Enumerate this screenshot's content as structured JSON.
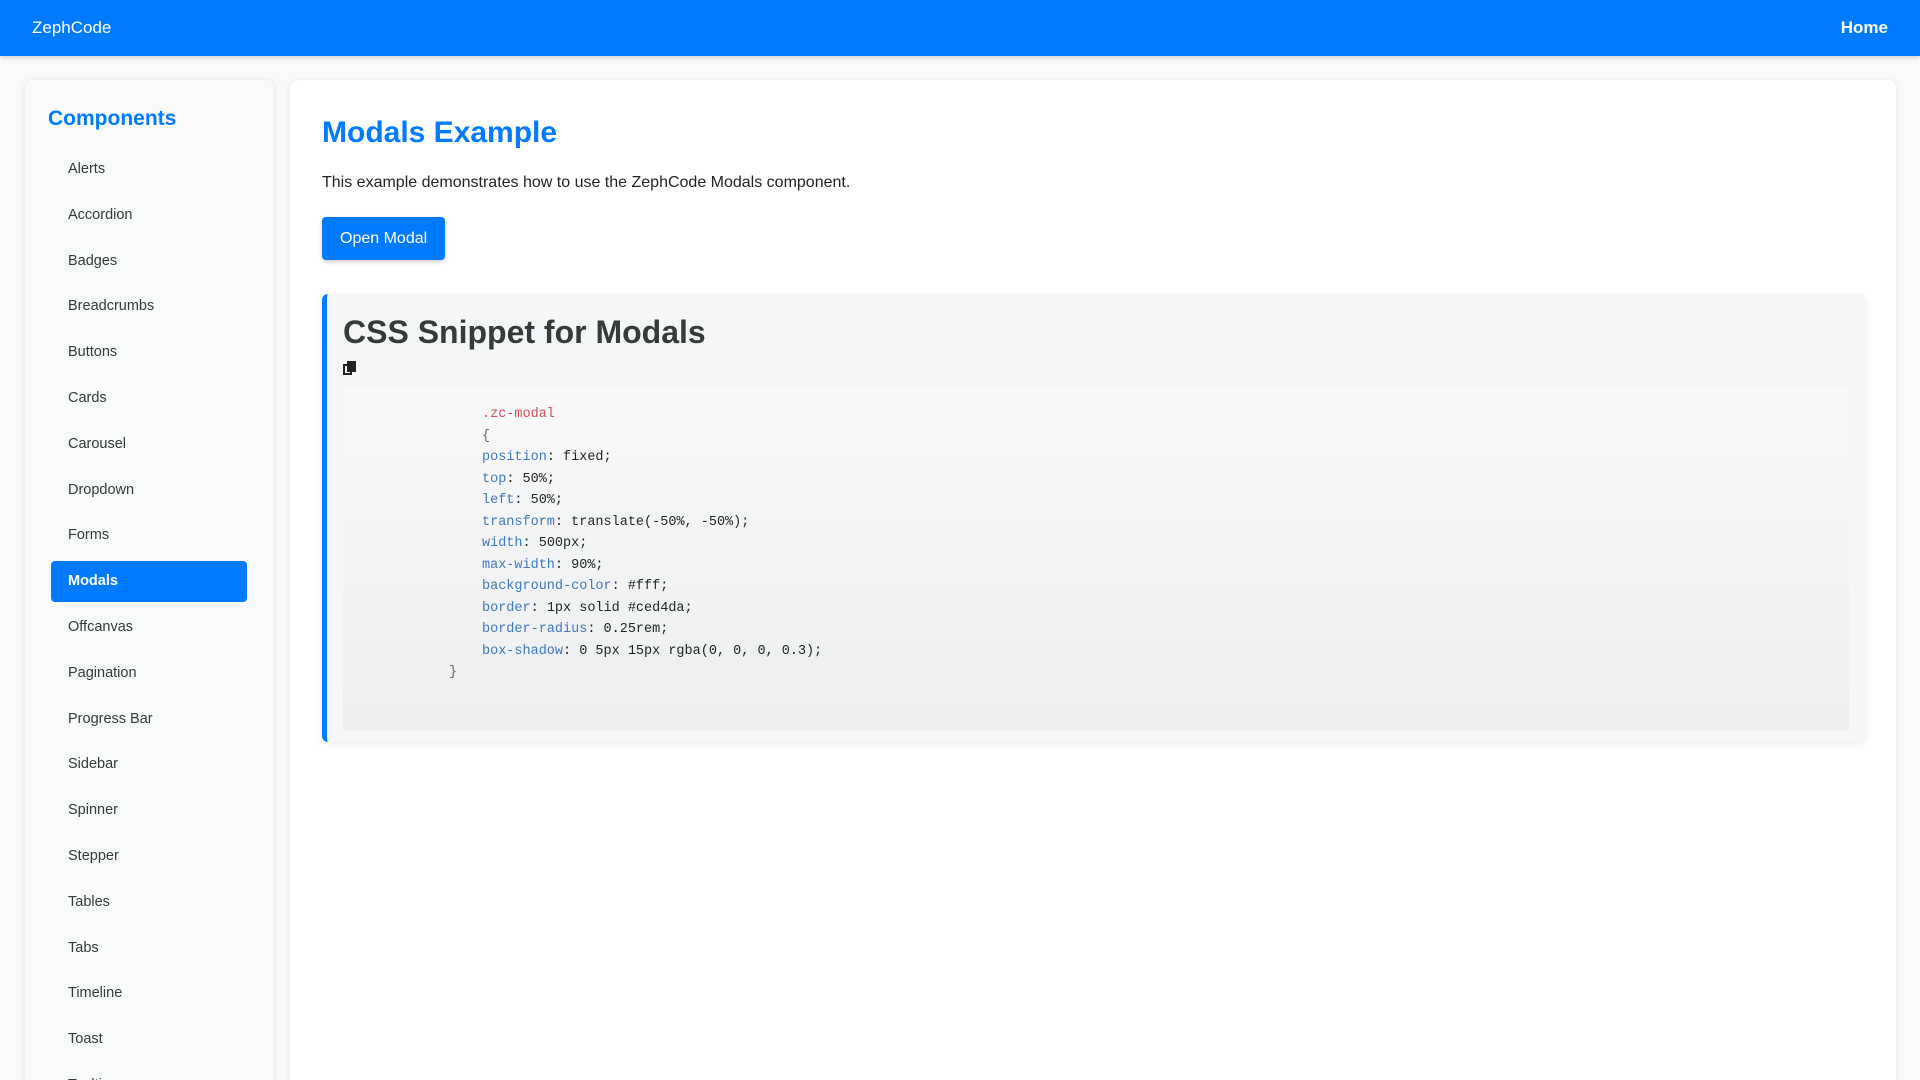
{
  "navbar": {
    "brand": "ZephCode",
    "home": "Home",
    "color": "#007bff"
  },
  "sidebar": {
    "title": "Components",
    "items": [
      {
        "label": "Alerts",
        "active": false
      },
      {
        "label": "Accordion",
        "active": false
      },
      {
        "label": "Badges",
        "active": false
      },
      {
        "label": "Breadcrumbs",
        "active": false
      },
      {
        "label": "Buttons",
        "active": false
      },
      {
        "label": "Cards",
        "active": false
      },
      {
        "label": "Carousel",
        "active": false
      },
      {
        "label": "Dropdown",
        "active": false
      },
      {
        "label": "Forms",
        "active": false
      },
      {
        "label": "Modals",
        "active": true
      },
      {
        "label": "Offcanvas",
        "active": false
      },
      {
        "label": "Pagination",
        "active": false
      },
      {
        "label": "Progress Bar",
        "active": false
      },
      {
        "label": "Sidebar",
        "active": false
      },
      {
        "label": "Spinner",
        "active": false
      },
      {
        "label": "Stepper",
        "active": false
      },
      {
        "label": "Tables",
        "active": false
      },
      {
        "label": "Tabs",
        "active": false
      },
      {
        "label": "Timeline",
        "active": false
      },
      {
        "label": "Toast",
        "active": false
      },
      {
        "label": "Tooltips",
        "active": false
      }
    ]
  },
  "main": {
    "title": "Modals Example",
    "description": "This example demonstrates how to use the ZephCode Modals component.",
    "open_button": "Open Modal"
  },
  "snippet": {
    "title": "CSS Snippet for Modals",
    "copy_icon": "copy-icon",
    "selector": ".zc-modal",
    "open_brace": "{",
    "close_brace": "}",
    "declarations": [
      {
        "prop": "position",
        "value": "fixed;"
      },
      {
        "prop": "top",
        "value": "50%;"
      },
      {
        "prop": "left",
        "value": "50%;"
      },
      {
        "prop": "transform",
        "value": "translate(-50%, -50%);"
      },
      {
        "prop": "width",
        "value": "500px;"
      },
      {
        "prop": "max-width",
        "value": "90%;"
      },
      {
        "prop": "background-color",
        "value": "#fff;"
      },
      {
        "prop": "border",
        "value": "1px solid #ced4da;"
      },
      {
        "prop": "border-radius",
        "value": "0.25rem;"
      },
      {
        "prop": "box-shadow",
        "value": "0 5px 15px rgba(0, 0, 0, 0.3);"
      }
    ]
  }
}
